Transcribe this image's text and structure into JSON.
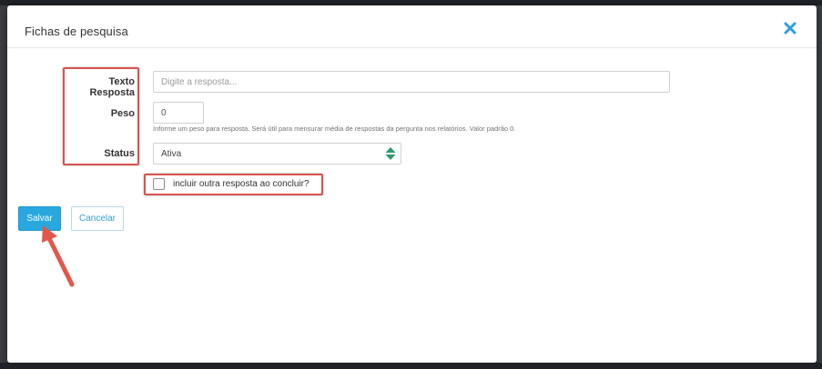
{
  "modal": {
    "title": "Fichas de pesquisa",
    "close_icon": "close-x-icon"
  },
  "form": {
    "texto": {
      "label": "Texto Resposta",
      "placeholder": "Digite a resposta...",
      "value": ""
    },
    "peso": {
      "label": "Peso",
      "value": "0",
      "help": "Informe um peso para resposta. Será útil para mensurar média de respostas da pergunta nos relatórios. Valor padrão 0."
    },
    "status": {
      "label": "Status",
      "value": "Ativa"
    },
    "incluir": {
      "label": "incluir outra resposta ao concluir?",
      "checked": false
    }
  },
  "buttons": {
    "save_label": "Salvar",
    "cancel_label": "Cancelar"
  },
  "colors": {
    "accent": "#29a8e0",
    "highlight": "#d9534f",
    "select_arrows": "#2e9b6f"
  }
}
